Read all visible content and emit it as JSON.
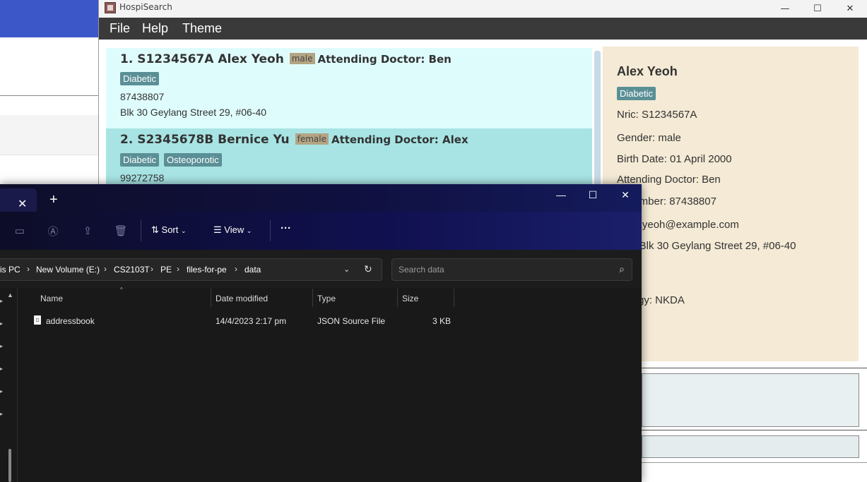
{
  "app": {
    "title": "HospiSearch",
    "menu": [
      "File",
      "Help",
      "Theme"
    ],
    "window_controls": {
      "minimize": "—",
      "maximize": "☐",
      "close": "✕"
    }
  },
  "patients": [
    {
      "index": "1.",
      "nric": "S1234567A",
      "name": "Alex Yeoh",
      "gender": "male",
      "doctor": "Attending Doctor: Ben",
      "tags": [
        "Diabetic"
      ],
      "phone": "87438807",
      "address": "Blk 30 Geylang Street 29, #06-40"
    },
    {
      "index": "2.",
      "nric": "S2345678B",
      "name": "Bernice Yu",
      "gender": "female",
      "doctor": "Attending Doctor: Alex",
      "tags": [
        "Diabetic",
        "Osteoporotic"
      ],
      "phone": "99272758"
    }
  ],
  "detail": {
    "name": "Alex Yeoh",
    "tag": "Diabetic",
    "nric": "Nric: S1234567A",
    "gender": "Gender: male",
    "birth_date": "Birth Date: 01 April 2000",
    "doctor": "Attending Doctor: Ben",
    "phone": "e Number: 87438807",
    "email": ": alexyeoh@example.com",
    "address": "ess: Blk 30 Geylang Street 29, #06-40",
    "allergy": "Allergy: NKDA",
    "badge_color": "#8a6b52"
  },
  "explorer": {
    "tab_close": "✕",
    "new_tab": "+",
    "toolbar": {
      "sort": "Sort",
      "view": "View",
      "more": "···"
    },
    "breadcrumb": [
      "is PC",
      "New Volume (E:)",
      "CS2103T",
      "PE",
      "files-for-pe",
      "data"
    ],
    "search_placeholder": "Search data",
    "columns": {
      "name": "Name",
      "date": "Date modified",
      "type": "Type",
      "size": "Size"
    },
    "files": [
      {
        "name": "addressbook",
        "date": "14/4/2023 2:17 pm",
        "type": "JSON Source File",
        "size": "3 KB"
      }
    ]
  },
  "colors": {
    "card_selected": "#dffcfc",
    "card_alt": "#a8e4e4",
    "tag": "#5b8f96",
    "detail_bg": "#f4ead5",
    "menubar": "#3a3a3a"
  }
}
